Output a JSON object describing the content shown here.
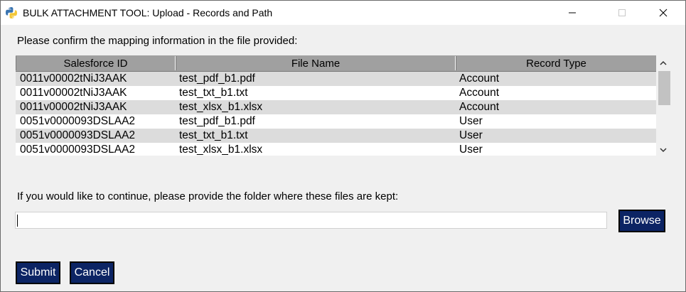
{
  "window": {
    "title": "BULK ATTACHMENT TOOL: Upload - Records and Path",
    "icon": "python-icon",
    "controls": [
      "minimize-icon",
      "maximize-icon",
      "close-icon"
    ]
  },
  "prompt_mapping": "Please confirm the mapping information in the file provided:",
  "table": {
    "columns": [
      "Salesforce ID",
      "File Name",
      "Record Type"
    ],
    "rows": [
      [
        "0011v00002tNiJ3AAK",
        "test_pdf_b1.pdf",
        "Account"
      ],
      [
        "0011v00002tNiJ3AAK",
        "test_txt_b1.txt",
        "Account"
      ],
      [
        "0011v00002tNiJ3AAK",
        "test_xlsx_b1.xlsx",
        "Account"
      ],
      [
        "0051v0000093DSLAA2",
        "test_pdf_b1.pdf",
        "User"
      ],
      [
        "0051v0000093DSLAA2",
        "test_txt_b1.txt",
        "User"
      ],
      [
        "0051v0000093DSLAA2",
        "test_xlsx_b1.xlsx",
        "User"
      ]
    ]
  },
  "prompt_folder": "If you would like to continue, please provide the folder where these files are kept:",
  "folder_input": {
    "value": "",
    "placeholder": ""
  },
  "buttons": {
    "browse": "Browse",
    "submit": "Submit",
    "cancel": "Cancel"
  },
  "colors": {
    "button_bg": "#0c2464",
    "header_bg": "#a0a0a0",
    "row_stripe": "#dcdcdc",
    "window_bg": "#f0f0f0"
  }
}
